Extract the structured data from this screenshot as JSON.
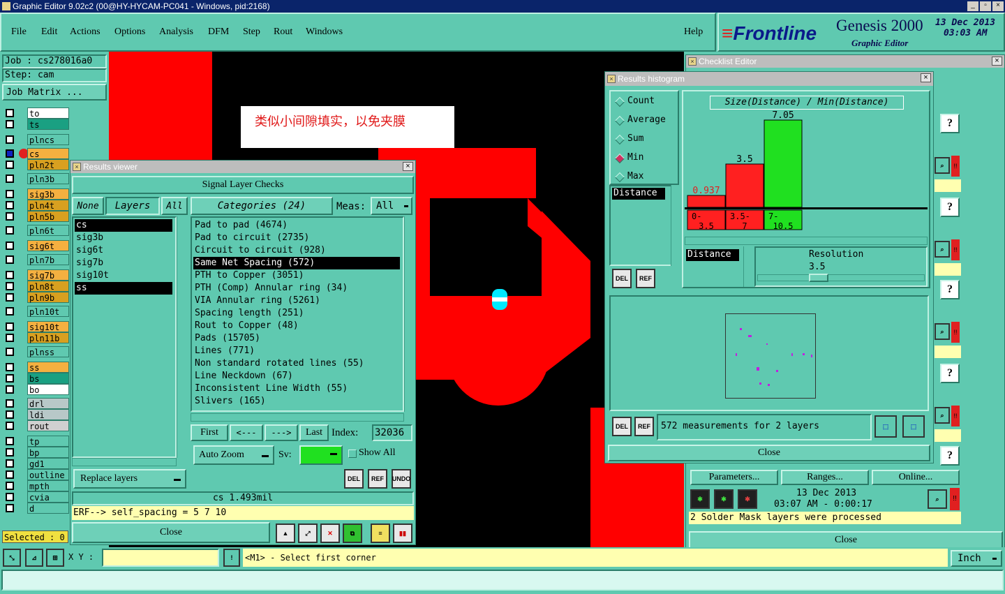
{
  "window": {
    "title": "Graphic Editor 9.02c2 (00@HY-HYCAM-PC041 - Windows, pid:2168)"
  },
  "menu": [
    "File",
    "Edit",
    "Actions",
    "Options",
    "Analysis",
    "DFM",
    "Step",
    "Rout",
    "Windows"
  ],
  "help": "Help",
  "brand": {
    "logo": "Frontline",
    "product": "Genesis 2000",
    "sub": "Graphic Editor",
    "date": "13 Dec 2013",
    "time": "03:03 AM"
  },
  "job": {
    "job": "Job : cs278016a0",
    "step": "Step: cam",
    "matrix": "Job Matrix ..."
  },
  "layers": [
    {
      "name": "to",
      "color": "#ffffff"
    },
    {
      "name": "ts",
      "color": "#1aa082"
    },
    {
      "name": "plncs",
      "color": "#5fc9b0"
    },
    {
      "name": "cs",
      "color": "#f4b040"
    },
    {
      "name": "pln2t",
      "color": "#d8a020"
    },
    {
      "name": "pln3b",
      "color": "#5fc9b0"
    },
    {
      "name": "sig3b",
      "color": "#f4b040"
    },
    {
      "name": "pln4t",
      "color": "#d8a020"
    },
    {
      "name": "pln5b",
      "color": "#d8a020"
    },
    {
      "name": "pln6t",
      "color": "#5fc9b0"
    },
    {
      "name": "sig6t",
      "color": "#f4b040"
    },
    {
      "name": "pln7b",
      "color": "#5fc9b0"
    },
    {
      "name": "sig7b",
      "color": "#f4b040"
    },
    {
      "name": "pln8t",
      "color": "#d8a020"
    },
    {
      "name": "pln9b",
      "color": "#d8a020"
    },
    {
      "name": "pln10t",
      "color": "#5fc9b0"
    },
    {
      "name": "sig10t",
      "color": "#f4b040"
    },
    {
      "name": "pln11b",
      "color": "#d8a020"
    },
    {
      "name": "plnss",
      "color": "#5fc9b0"
    },
    {
      "name": "ss",
      "color": "#f4b040"
    },
    {
      "name": "bs",
      "color": "#1aa082"
    },
    {
      "name": "bo",
      "color": "#ffffff"
    },
    {
      "name": "drl",
      "color": "#b8c8c8"
    },
    {
      "name": "ldi",
      "color": "#b8c8c8"
    },
    {
      "name": "rout",
      "color": "#d0d0d0"
    },
    {
      "name": "tp",
      "color": "#5fc9b0"
    },
    {
      "name": "bp",
      "color": "#5fc9b0"
    },
    {
      "name": "gd1",
      "color": "#5fc9b0"
    },
    {
      "name": "outline",
      "color": "#5fc9b0"
    },
    {
      "name": "mpth",
      "color": "#5fc9b0"
    },
    {
      "name": "cvia",
      "color": "#5fc9b0"
    },
    {
      "name": "d",
      "color": "#5fc9b0"
    }
  ],
  "selected": "Selected : 0",
  "annotation": "类似小间隙填实，以免夹膜",
  "results_viewer": {
    "title": "Results viewer",
    "header": "Signal Layer Checks",
    "none": "None",
    "layers_label": "Layers",
    "all": "All",
    "categories_label": "Categories (24)",
    "meas": "Meas:",
    "meas_value": "All",
    "layer_list": [
      "cs",
      "sig3b",
      "sig6t",
      "sig7b",
      "sig10t",
      "ss"
    ],
    "categories": [
      "Pad to pad (4674)",
      "Pad to circuit (2735)",
      "Circuit to circuit (928)",
      "Same Net Spacing (572)",
      "PTH to Copper (3051)",
      "PTH (Comp) Annular ring (34)",
      "VIA Annular ring (5261)",
      "Spacing length (251)",
      "Rout to Copper (48)",
      "Pads (15705)",
      "Lines (771)",
      "Non standard rotated lines (55)",
      "Line Neckdown (67)",
      "Inconsistent Line Width (55)",
      "Slivers (165)"
    ],
    "first": "First",
    "prev": "<---",
    "next": "--->",
    "last": "Last",
    "index_label": "Index:",
    "index_value": "32036",
    "auto_zoom": "Auto Zoom",
    "sv": "Sv:",
    "show_all": "Show All",
    "replace_layers": "Replace layers",
    "value": "cs 1.493mil",
    "erf": "ERF--> self_spacing = 5 7 10",
    "close": "Close"
  },
  "histogram": {
    "title": "Results histogram",
    "radios": [
      "Count",
      "Average",
      "Sum",
      "Min",
      "Max"
    ],
    "selected_radio": "Min",
    "chart_title": "Size(Distance) / Min(Distance)",
    "left_list_label": "Distance",
    "bars": [
      {
        "label": "0.937",
        "bin": "0-\n3.5",
        "value": 0.937,
        "color": "#ff2020"
      },
      {
        "label": "3.5",
        "bin": "3.5-\n7",
        "value": 3.5,
        "color": "#ff2020"
      },
      {
        "label": "7.05",
        "bin": "7-\n10.5",
        "value": 7.05,
        "color": "#20e020"
      }
    ],
    "distance_label": "Distance",
    "resolution_label": "Resolution",
    "resolution_value": "3.5",
    "measurements": "572 measurements for 2 layers",
    "close": "Close"
  },
  "checklist": {
    "title": "Checklist Editor",
    "parameters": "Parameters...",
    "ranges": "Ranges...",
    "online": "Online...",
    "date": "13 Dec 2013",
    "time": "03:07 AM - 0:00:17",
    "status": "2 Solder Mask layers were processed",
    "close": "Close"
  },
  "bottom": {
    "xy": "X Y :",
    "prompt": "<M1> - Select first corner",
    "units": "Inch"
  }
}
